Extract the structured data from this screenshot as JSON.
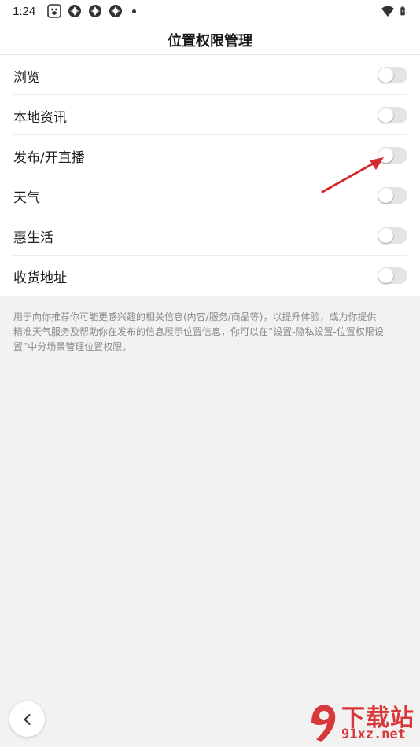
{
  "status_bar": {
    "time": "1:24",
    "left_icons": [
      "baidu-app-icon",
      "app-notification-icon",
      "app-notification-icon",
      "app-notification-icon"
    ],
    "right_icons": [
      "wifi-icon",
      "battery-charging-icon"
    ]
  },
  "header": {
    "title": "位置权限管理"
  },
  "settings": [
    {
      "label": "浏览",
      "enabled": false
    },
    {
      "label": "本地资讯",
      "enabled": false
    },
    {
      "label": "发布/开直播",
      "enabled": false
    },
    {
      "label": "天气",
      "enabled": false
    },
    {
      "label": "惠生活",
      "enabled": false
    },
    {
      "label": "收货地址",
      "enabled": false
    }
  ],
  "description": {
    "line1": "用于向你推荐你可能更感兴趣的相关信息(内容/服务/商品等)，以提升体验，或为你提供",
    "line2": "精准天气服务及帮助你在发布的信息展示位置信息，你可以在“设置-隐私设置-位置权限设",
    "line3": "置”中分场景管理位置权限。"
  },
  "navigation": {
    "back_icon": "chevron-left-icon"
  },
  "watermark": {
    "text": "下载站",
    "url": "91xz.net"
  },
  "colors": {
    "accent_red": "#d9383a",
    "toggle_off": "#e4e4e4",
    "description_text": "#8a8a8a"
  }
}
